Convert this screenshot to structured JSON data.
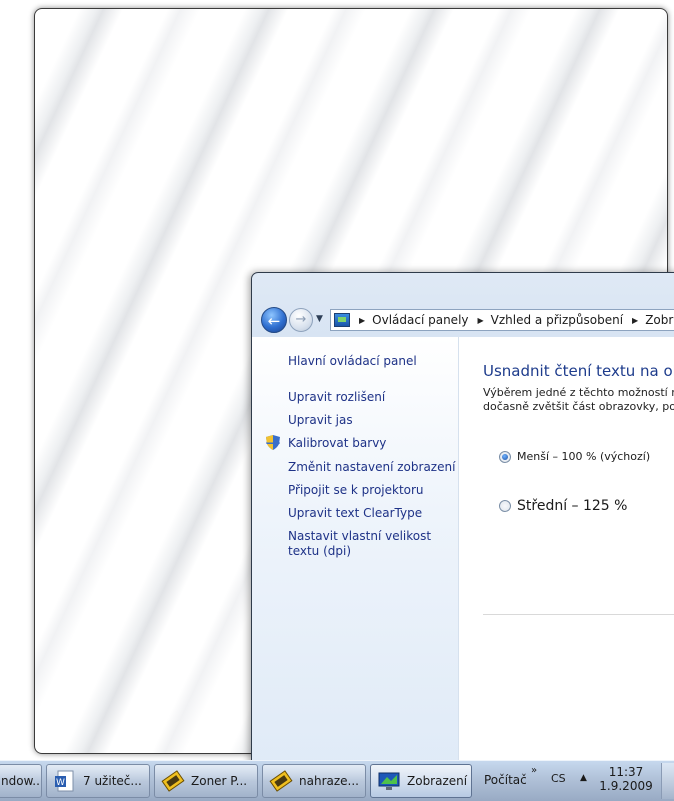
{
  "control_panel": {
    "address": {
      "crumbs": [
        "Ovládací panely",
        "Vzhled a přizpůsobení",
        "Zobrazení"
      ]
    },
    "sidebar": {
      "home_link": "Hlavní ovládací panel",
      "links": [
        "Upravit rozlišení",
        "Upravit jas",
        "Kalibrovat barvy",
        "Změnit nastavení zobrazení",
        "Připojit se k projektoru",
        "Upravit text ClearType",
        "Nastavit vlastní velikost textu (dpi)"
      ]
    },
    "content": {
      "heading": "Usnadnit čtení textu na obra",
      "description_line1": "Výběrem jedné z těchto možností mu",
      "description_line2": "dočasně zvětšit část obrazovky, použ",
      "options": [
        {
          "label": "Menší – 100 % (výchozí)",
          "selected": true
        },
        {
          "label": "Střední – 125 %",
          "selected": false
        }
      ]
    }
  },
  "taskbar": {
    "buttons": [
      {
        "label": "ndow...",
        "icon": "window-icon"
      },
      {
        "label": "7 užiteč...",
        "icon": "word-document-icon"
      },
      {
        "label": "Zoner P...",
        "icon": "zoner-icon"
      },
      {
        "label": "nahraze...",
        "icon": "zoner-icon"
      },
      {
        "label": "Zobrazení",
        "icon": "display-icon",
        "active": true
      }
    ],
    "toolbar_label": "Počítač",
    "language": "CS",
    "time": "11:37",
    "date": "1.9.2009"
  },
  "colors": {
    "link": "#1e3287",
    "heading": "#1e3c8c",
    "taskbar": "#aebfd6"
  }
}
